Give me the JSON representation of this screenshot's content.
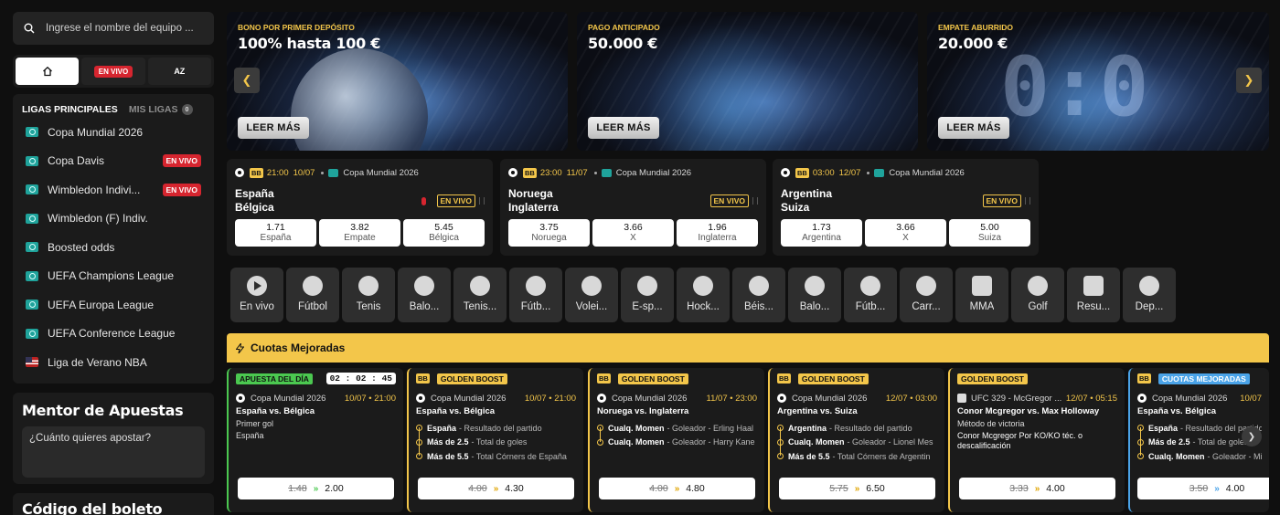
{
  "search": {
    "placeholder": "Ingrese el nombre del equipo ..."
  },
  "nav": {
    "home_icon": "home-icon",
    "live_label": "EN VIVO",
    "az_label": "AZ"
  },
  "leagues": {
    "tab_main": "LIGAS PRINCIPALES",
    "tab_mine": "MIS LIGAS",
    "mine_count": "0",
    "items": [
      {
        "label": "Copa Mundial 2026",
        "live": ""
      },
      {
        "label": "Copa Davis",
        "live": "EN VIVO"
      },
      {
        "label": "Wimbledon Indivi...",
        "live": "EN VIVO"
      },
      {
        "label": "Wimbledon (F) Indiv.",
        "live": ""
      },
      {
        "label": "Boosted odds",
        "live": ""
      },
      {
        "label": "UEFA Champions League",
        "live": ""
      },
      {
        "label": "UEFA Europa League",
        "live": ""
      },
      {
        "label": "UEFA Conference League",
        "live": ""
      },
      {
        "label": "Liga de Verano NBA",
        "live": ""
      }
    ]
  },
  "mentor": {
    "title": "Mentor de Apuestas",
    "question": "¿Cuánto quieres apostar?"
  },
  "ticket": {
    "title": "Código del boleto"
  },
  "banners": [
    {
      "subtitle": "BONO POR PRIMER DEPÓSITO",
      "title": "100% hasta 100 €",
      "button": "LEER MÁS"
    },
    {
      "subtitle": "PAGO ANTICIPADO",
      "title": "50.000 €",
      "button": "LEER MÁS"
    },
    {
      "subtitle": "EMPATE ABURRIDO",
      "title": "20.000 €",
      "button": "LEER MÁS",
      "art": "0:0"
    }
  ],
  "banner_arrows": {
    "prev": "❮",
    "next": "❯"
  },
  "matches": [
    {
      "bb": "BB",
      "time": "21:00",
      "date": "10/07",
      "league": "Copa Mundial 2026",
      "home": "España",
      "away": "Bélgica",
      "status": "EN VIVO",
      "odds": [
        {
          "v": "1.71",
          "l": "España"
        },
        {
          "v": "3.82",
          "l": "Empate"
        },
        {
          "v": "5.45",
          "l": "Bélgica"
        }
      ]
    },
    {
      "bb": "BB",
      "time": "23:00",
      "date": "11/07",
      "league": "Copa Mundial 2026",
      "home": "Noruega",
      "away": "Inglaterra",
      "status": "EN VIVO",
      "odds": [
        {
          "v": "3.75",
          "l": "Noruega"
        },
        {
          "v": "3.66",
          "l": "X"
        },
        {
          "v": "1.96",
          "l": "Inglaterra"
        }
      ]
    },
    {
      "bb": "BB",
      "time": "03:00",
      "date": "12/07",
      "league": "Copa Mundial 2026",
      "home": "Argentina",
      "away": "Suiza",
      "status": "EN VIVO",
      "odds": [
        {
          "v": "1.73",
          "l": "Argentina"
        },
        {
          "v": "3.66",
          "l": "X"
        },
        {
          "v": "5.00",
          "l": "Suiza"
        }
      ]
    }
  ],
  "sports": [
    "En vivo",
    "Fútbol",
    "Tenis",
    "Balo...",
    "Tenis...",
    "Fútb...",
    "Volei...",
    "E-sp...",
    "Hock...",
    "Béis...",
    "Balo...",
    "Fútb...",
    "Carr...",
    "MMA",
    "Golf",
    "Resu...",
    "Dep..."
  ],
  "cuotas": {
    "title": "Cuotas Mejoradas",
    "cards": [
      {
        "tag1": "APUESTA DEL DÍA",
        "timer": "02 : 02 : 45",
        "league": "Copa Mundial 2026",
        "time": "10/07 • 21:00",
        "match": "España vs. Bélgica",
        "line1": "Primer gol",
        "line2": "España",
        "old": "1.48",
        "new": "2.00"
      },
      {
        "tag0": "BB",
        "tag1": "GOLDEN BOOST",
        "league": "Copa Mundial 2026",
        "time": "10/07 • 21:00",
        "match": "España vs. Bélgica",
        "legs": [
          {
            "b": "España",
            "d": "- Resultado del partido"
          },
          {
            "b": "Más de 2.5",
            "d": "- Total de goles"
          },
          {
            "b": "Más de 5.5",
            "d": "- Total Córners de España"
          }
        ],
        "old": "4.00",
        "new": "4.30"
      },
      {
        "tag0": "BB",
        "tag1": "GOLDEN BOOST",
        "league": "Copa Mundial 2026",
        "time": "11/07 • 23:00",
        "match": "Noruega vs. Inglaterra",
        "legs": [
          {
            "b": "Cualq. Momen",
            "d": "- Goleador - Erling Haal"
          },
          {
            "b": "Cualq. Momen",
            "d": "- Goleador - Harry Kane"
          }
        ],
        "old": "4.00",
        "new": "4.80"
      },
      {
        "tag0": "BB",
        "tag1": "GOLDEN BOOST",
        "league": "Copa Mundial 2026",
        "time": "12/07 • 03:00",
        "match": "Argentina vs. Suiza",
        "legs": [
          {
            "b": "Argentina",
            "d": "- Resultado del partido"
          },
          {
            "b": "Cualq. Momen",
            "d": "- Goleador - Lionel Mes"
          },
          {
            "b": "Más de 5.5",
            "d": "- Total Córners de Argentin"
          }
        ],
        "old": "5.75",
        "new": "6.50"
      },
      {
        "tag1": "GOLDEN BOOST",
        "league": "UFC 329 - McGregor ...",
        "time": "12/07 • 05:15",
        "match": "Conor Mcgregor vs. Max Holloway",
        "line1": "Método de victoria",
        "line2": "Conor Mcgregor Por KO/KO téc. o descalificación",
        "old": "3.33",
        "new": "4.00"
      },
      {
        "tag0": "BB",
        "tag1": "CUOTAS MEJORADAS",
        "league": "Copa Mundial 2026",
        "time": "10/07",
        "match": "España vs. Bélgica",
        "legs": [
          {
            "b": "España",
            "d": "- Resultado del partido"
          },
          {
            "b": "Más de 2.5",
            "d": "- Total de goles"
          },
          {
            "b": "Cualq. Momen",
            "d": "- Goleador - Mike"
          }
        ],
        "old": "3.50",
        "new": "4.00"
      }
    ]
  },
  "next_arrow": "❯",
  "colors": {
    "accent": "#f3c64a",
    "live": "#d6252f",
    "green": "#4bc850",
    "blue": "#4aa3e8",
    "teal": "#1fa39b"
  }
}
